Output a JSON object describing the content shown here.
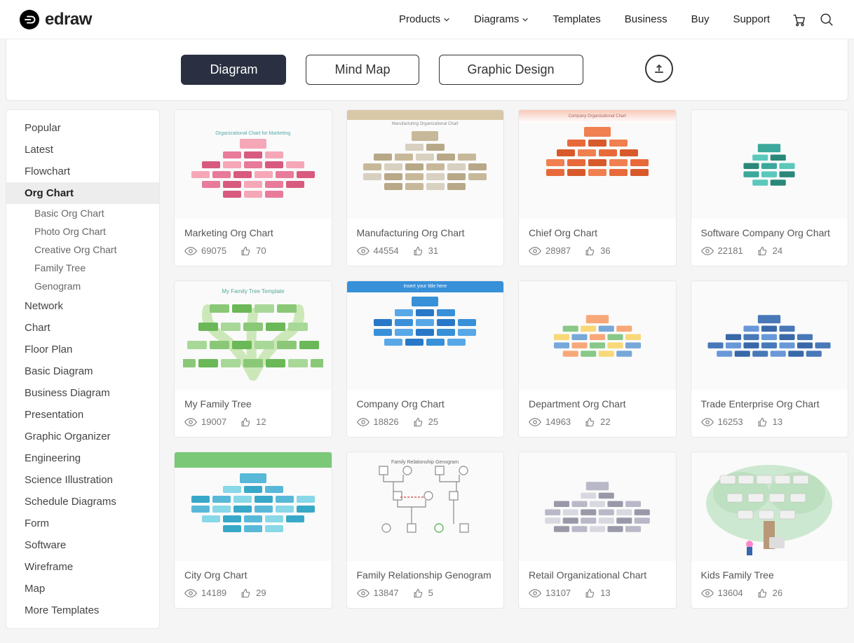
{
  "brand": "edraw",
  "nav": [
    "Products",
    "Diagrams",
    "Templates",
    "Business",
    "Buy",
    "Support"
  ],
  "nav_dropdown": [
    true,
    true,
    false,
    false,
    false,
    false
  ],
  "tabs": [
    "Diagram",
    "Mind Map",
    "Graphic Design"
  ],
  "active_tab": 0,
  "sidebar": [
    {
      "label": "Popular"
    },
    {
      "label": "Latest"
    },
    {
      "label": "Flowchart"
    },
    {
      "label": "Org Chart",
      "active": true,
      "subs": [
        "Basic Org Chart",
        "Photo Org Chart",
        "Creative Org Chart",
        "Family Tree",
        "Genogram"
      ]
    },
    {
      "label": "Network"
    },
    {
      "label": "Chart"
    },
    {
      "label": "Floor Plan"
    },
    {
      "label": "Basic Diagram"
    },
    {
      "label": "Business Diagram"
    },
    {
      "label": "Presentation"
    },
    {
      "label": "Graphic Organizer"
    },
    {
      "label": "Engineering"
    },
    {
      "label": "Science Illustration"
    },
    {
      "label": "Schedule Diagrams"
    },
    {
      "label": "Form"
    },
    {
      "label": "Software"
    },
    {
      "label": "Wireframe"
    },
    {
      "label": "Map"
    },
    {
      "label": "More Templates"
    }
  ],
  "templates": [
    {
      "title": "Marketing Org Chart",
      "views": "69075",
      "likes": "70",
      "theme": "pink"
    },
    {
      "title": "Manufacturing Org Chart",
      "views": "44554",
      "likes": "31",
      "theme": "beige"
    },
    {
      "title": "Chief Org Chart",
      "views": "28987",
      "likes": "36",
      "theme": "orange"
    },
    {
      "title": "Software Company Org Chart",
      "views": "22181",
      "likes": "24",
      "theme": "teal"
    },
    {
      "title": "My Family Tree",
      "views": "19007",
      "likes": "12",
      "theme": "green"
    },
    {
      "title": "Company Org Chart",
      "views": "18826",
      "likes": "25",
      "theme": "blue"
    },
    {
      "title": "Department Org Chart",
      "views": "14963",
      "likes": "22",
      "theme": "pastel"
    },
    {
      "title": "Trade Enterprise Org Chart",
      "views": "16253",
      "likes": "13",
      "theme": "darkblue"
    },
    {
      "title": "City Org Chart",
      "views": "14189",
      "likes": "29",
      "theme": "cyan"
    },
    {
      "title": "Family Relationship Genogram",
      "views": "13847",
      "likes": "5",
      "theme": "genogram"
    },
    {
      "title": "Retail Organizational Chart",
      "views": "13107",
      "likes": "13",
      "theme": "gray"
    },
    {
      "title": "Kids Family Tree",
      "views": "13604",
      "likes": "26",
      "theme": "kidstree"
    }
  ],
  "colors": {
    "pink": [
      "#f5a7b8",
      "#e87a9a",
      "#d85a7e"
    ],
    "beige": [
      "#c8b89a",
      "#d8d0c0",
      "#b8a888"
    ],
    "orange": [
      "#f08050",
      "#e86a3a",
      "#d85a2a"
    ],
    "teal": [
      "#3aa89a",
      "#5ac8ba",
      "#2a887a"
    ],
    "green": [
      "#8ac878",
      "#6ab858",
      "#a8d898"
    ],
    "blue": [
      "#3890d8",
      "#58a8e8",
      "#2878c8"
    ],
    "pastel": [
      "#f8a878",
      "#88c888",
      "#f8d878",
      "#78a8d8"
    ],
    "darkblue": [
      "#4878b8",
      "#6898d8",
      "#3868a8"
    ],
    "cyan": [
      "#58b8d8",
      "#88d8e8",
      "#38a8c8"
    ],
    "gray": [
      "#b8b8c8",
      "#d8d8e0",
      "#9898a8"
    ]
  }
}
